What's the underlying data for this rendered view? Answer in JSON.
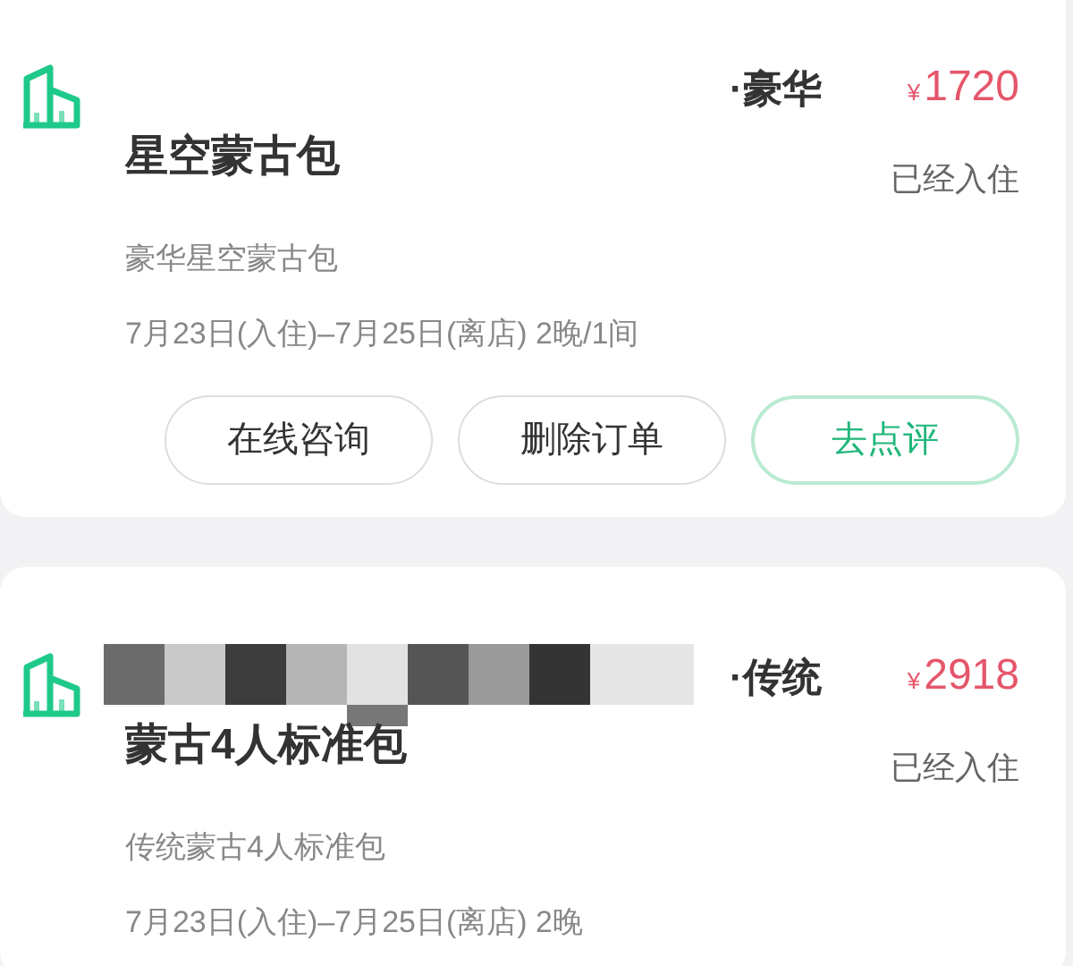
{
  "orders": [
    {
      "hotel_name": "·豪华",
      "redacted": false,
      "price_symbol": "¥",
      "price": "1720",
      "room": "星空蒙古包",
      "status": "已经入住",
      "package": "豪华星空蒙古包",
      "dates": "7月23日(入住)–7月25日(离店) 2晚/1间",
      "buttons": [
        {
          "label": "在线咨询",
          "kind": "default"
        },
        {
          "label": "删除订单",
          "kind": "default"
        },
        {
          "label": "去点评",
          "kind": "primary"
        }
      ]
    },
    {
      "hotel_name": "·传统",
      "redacted": true,
      "price_symbol": "¥",
      "price": "2918",
      "room": "蒙古4人标准包",
      "status": "已经入住",
      "package": "传统蒙古4人标准包",
      "dates": "7月23日(入住)–7月25日(离店) 2晚"
    }
  ]
}
